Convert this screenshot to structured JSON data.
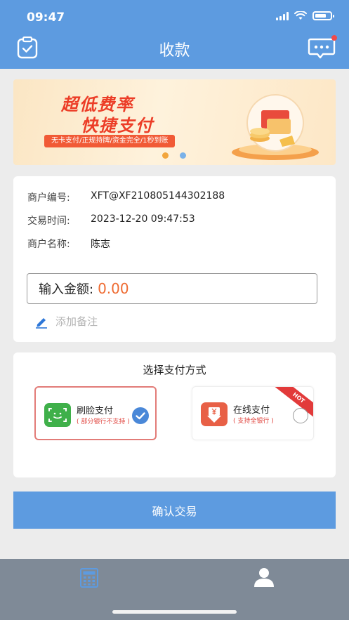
{
  "status_bar": {
    "time": "09:47"
  },
  "header": {
    "title": "收款",
    "left_icon": "clipboard-check-icon",
    "right_icon": "message-icon"
  },
  "banner": {
    "headline_1": "超低费率",
    "headline_2": "快捷支付",
    "tagline": "无卡支付/正规持牌/资金完全/1秒到账",
    "page_count": 2,
    "active_page": 1
  },
  "merchant": {
    "id_label": "商户编号:",
    "id_value": "XFT@XF210805144302188",
    "time_label": "交易时间:",
    "time_value": "2023-12-20 09:47:53",
    "name_label": "商户名称:",
    "name_value": "陈志"
  },
  "amount": {
    "label": "输入金额:",
    "value": "0.00"
  },
  "note": {
    "placeholder": "添加备注",
    "icon": "pencil-icon"
  },
  "payment": {
    "title": "选择支付方式",
    "options": [
      {
        "name": "刷脸支付",
        "subtitle": "( 部分银行不支持 )",
        "icon": "face-scan-icon",
        "selected": true
      },
      {
        "name": "在线支付",
        "subtitle": "( 支持全银行 )",
        "icon": "yuan-download-icon",
        "selected": false,
        "badge": "HOT"
      }
    ]
  },
  "confirm_button": {
    "label": "确认交易"
  },
  "tab_bar": {
    "tabs": [
      {
        "icon": "calculator-icon",
        "active": true
      },
      {
        "icon": "user-icon",
        "active": false
      }
    ]
  },
  "colors": {
    "primary": "#5d9be0",
    "amount": "#ee6a30",
    "selected_border": "#e27c78",
    "tab_bar": "#7f8a97"
  }
}
